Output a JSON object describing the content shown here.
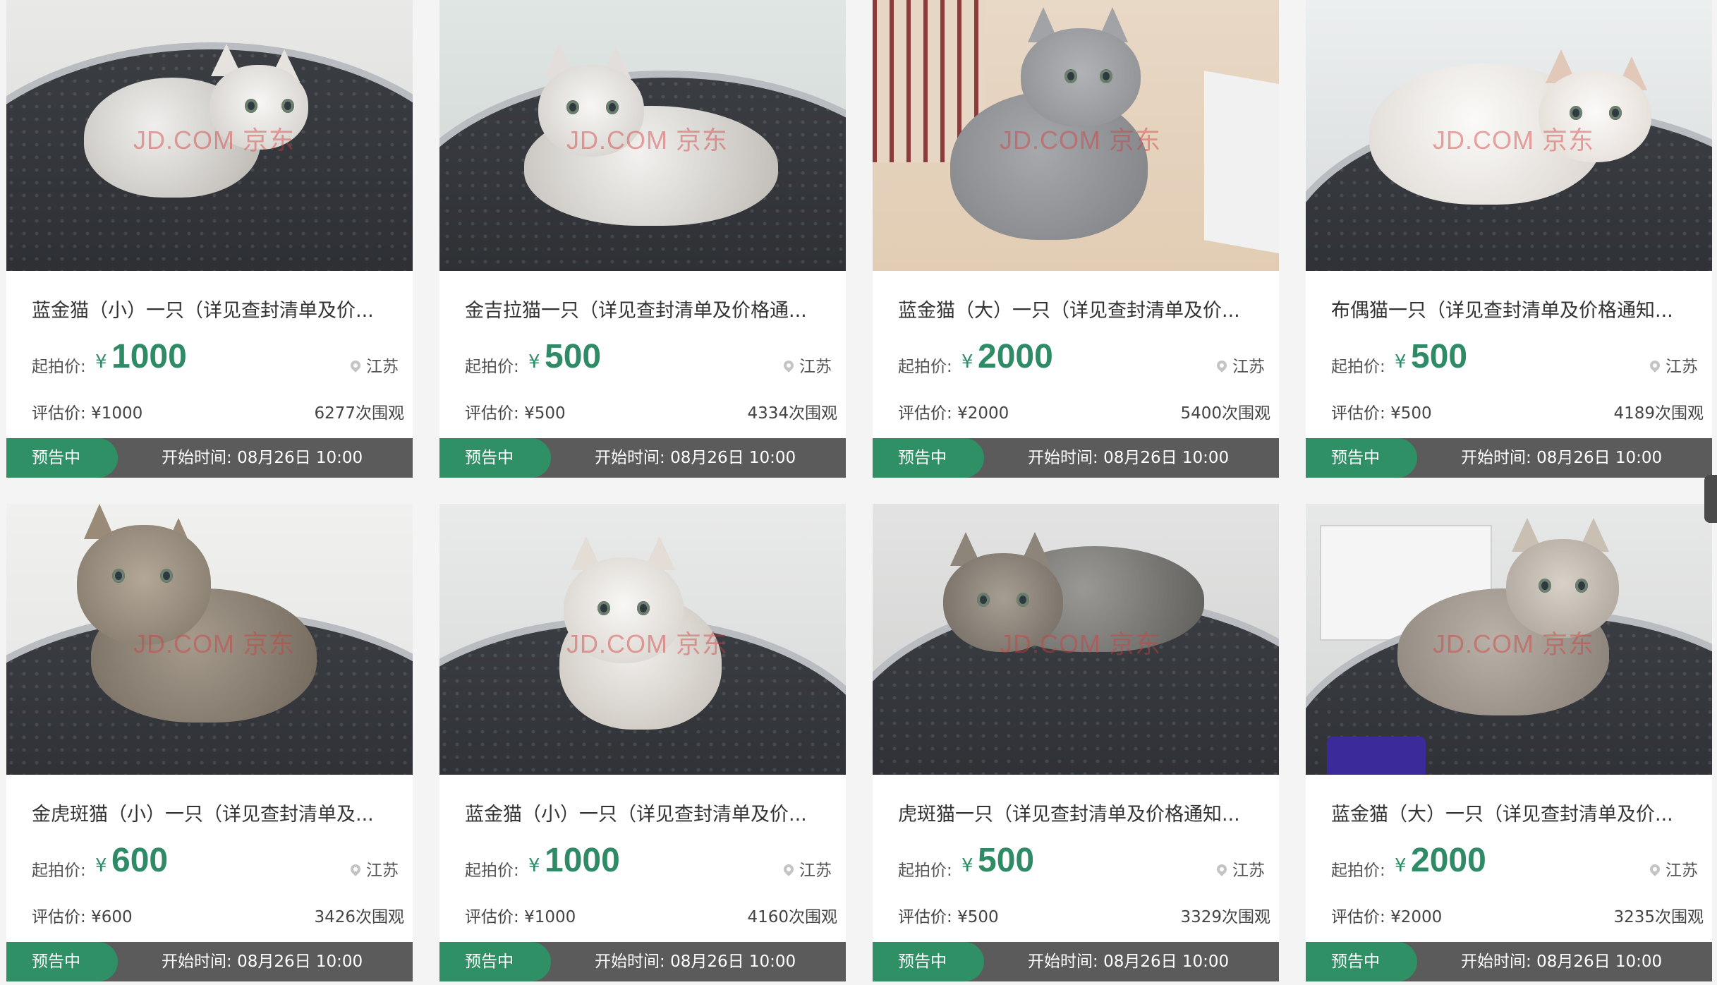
{
  "labels": {
    "start_price": "起拍价:",
    "currency": "¥",
    "eval_prefix": "评估价: ",
    "views_suffix": "次围观",
    "status": "预告中",
    "start_prefix": "开始时间: "
  },
  "watermark": "JD.COM 京东",
  "items": [
    {
      "title": "蓝金猫（小）一只（详见查封清单及价...",
      "price": "1000",
      "location": "江苏",
      "eval": "¥1000",
      "views": "6277",
      "start_time": "08月26日 10:00"
    },
    {
      "title": "金吉拉猫一只（详见查封清单及价格通...",
      "price": "500",
      "location": "江苏",
      "eval": "¥500",
      "views": "4334",
      "start_time": "08月26日 10:00"
    },
    {
      "title": "蓝金猫（大）一只（详见查封清单及价...",
      "price": "2000",
      "location": "江苏",
      "eval": "¥2000",
      "views": "5400",
      "start_time": "08月26日 10:00"
    },
    {
      "title": "布偶猫一只（详见查封清单及价格通知...",
      "price": "500",
      "location": "江苏",
      "eval": "¥500",
      "views": "4189",
      "start_time": "08月26日 10:00"
    },
    {
      "title": "金虎斑猫（小）一只（详见查封清单及...",
      "price": "600",
      "location": "江苏",
      "eval": "¥600",
      "views": "3426",
      "start_time": "08月26日 10:00"
    },
    {
      "title": "蓝金猫（小）一只（详见查封清单及价...",
      "price": "1000",
      "location": "江苏",
      "eval": "¥1000",
      "views": "4160",
      "start_time": "08月26日 10:00"
    },
    {
      "title": "虎斑猫一只（详见查封清单及价格通知...",
      "price": "500",
      "location": "江苏",
      "eval": "¥500",
      "views": "3329",
      "start_time": "08月26日 10:00"
    },
    {
      "title": "蓝金猫（大）一只（详见查封清单及价...",
      "price": "2000",
      "location": "江苏",
      "eval": "¥2000",
      "views": "3235",
      "start_time": "08月26日 10:00"
    }
  ],
  "colors": {
    "accent_green": "#2e8b66",
    "badge_green": "#2f8f65",
    "bar_gray": "#5b5b5b",
    "watermark_red": "rgba(210,60,60,0.45)"
  },
  "icons": {
    "location": "map-pin-icon"
  }
}
